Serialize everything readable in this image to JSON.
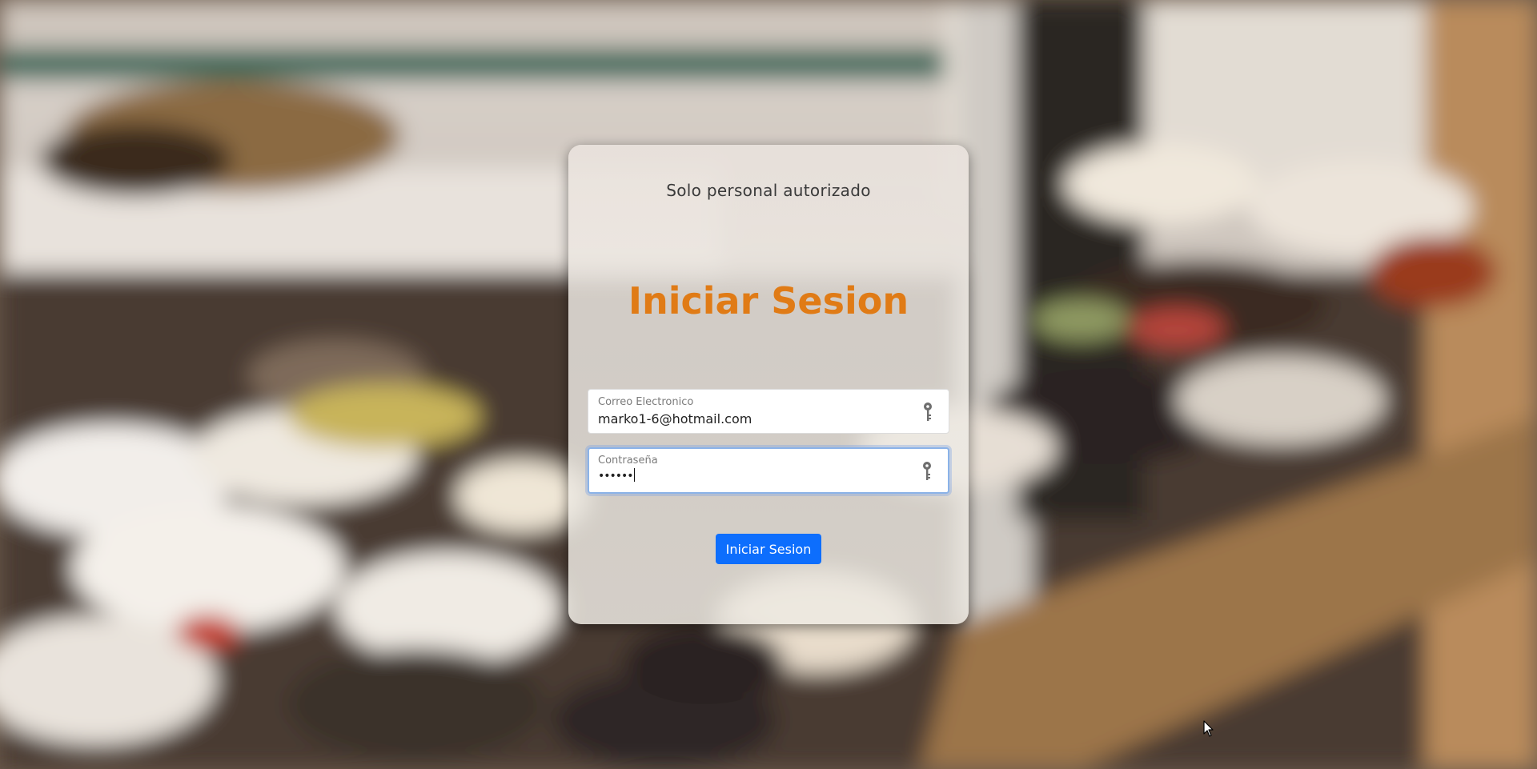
{
  "login": {
    "subtitle": "Solo personal autorizado",
    "title": "Iniciar Sesion",
    "email": {
      "label": "Correo Electronico",
      "value": "marko1-6@hotmail.com",
      "icon": "key-icon"
    },
    "password": {
      "label": "Contraseña",
      "value": "••••••",
      "icon": "key-icon"
    },
    "submit_label": "Iniciar Sesion"
  },
  "colors": {
    "title": "#e07b16",
    "button": "#0d6efd",
    "focus_ring": "#8bb3e8"
  }
}
